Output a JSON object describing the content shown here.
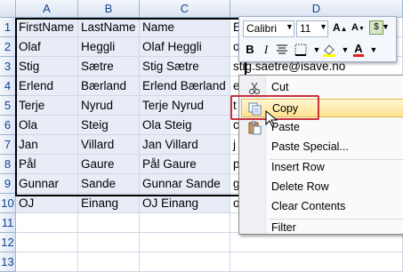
{
  "columns": [
    "A",
    "B",
    "C",
    "D"
  ],
  "rows": [
    "1",
    "2",
    "3",
    "4",
    "5",
    "6",
    "7",
    "8",
    "9",
    "10",
    "11",
    "12",
    "13"
  ],
  "cells": [
    [
      "FirstName",
      "LastName",
      "Name",
      ""
    ],
    [
      "Olaf",
      "Heggli",
      "Olaf Heggli",
      ""
    ],
    [
      "Stig",
      "Sætre",
      "Stig Sætre",
      "stig.saetre@isave.no"
    ],
    [
      "Erlend",
      "Bærland",
      "Erlend Bærland",
      ""
    ],
    [
      "Terje",
      "Nyrud",
      "Terje Nyrud",
      "t"
    ],
    [
      "Ola",
      "Steig",
      "Ola Steig",
      ""
    ],
    [
      "Jan",
      "Villard",
      "Jan Villard",
      "j"
    ],
    [
      "Pål",
      "Gaure",
      "Pål Gaure",
      ""
    ],
    [
      "Gunnar",
      "Sande",
      "Gunnar Sande",
      ""
    ],
    [
      "OJ",
      "Einang",
      "OJ Einang",
      ""
    ],
    [
      "",
      "",
      "",
      ""
    ],
    [
      "",
      "",
      "",
      ""
    ],
    [
      "",
      "",
      "",
      ""
    ]
  ],
  "peek_text": {
    "r1": "E",
    "r2": "o",
    "r4": "e",
    "r6": "c",
    "r8": "p",
    "r9": "g",
    "r10": "o"
  },
  "mini_toolbar": {
    "font": "Calibri",
    "size": "11",
    "bold": "B",
    "italic": "I",
    "currency": "$",
    "percent": "%"
  },
  "context_menu": {
    "items": [
      {
        "label": "Cut",
        "icon": "scissors-icon"
      },
      {
        "label": "Copy",
        "icon": "copy-icon",
        "highlighted": true
      },
      {
        "label": "Paste",
        "icon": "paste-icon"
      },
      {
        "label": "Paste Special...",
        "icon": ""
      },
      {
        "label": "Insert Row",
        "icon": ""
      },
      {
        "label": "Delete Row",
        "icon": ""
      },
      {
        "label": "Clear Contents",
        "icon": ""
      },
      {
        "label": "Filter",
        "icon": ""
      }
    ]
  },
  "colors": {
    "highlight_border": "#c8333b",
    "selection": "#e8ecf6",
    "header_text": "#15428b"
  }
}
